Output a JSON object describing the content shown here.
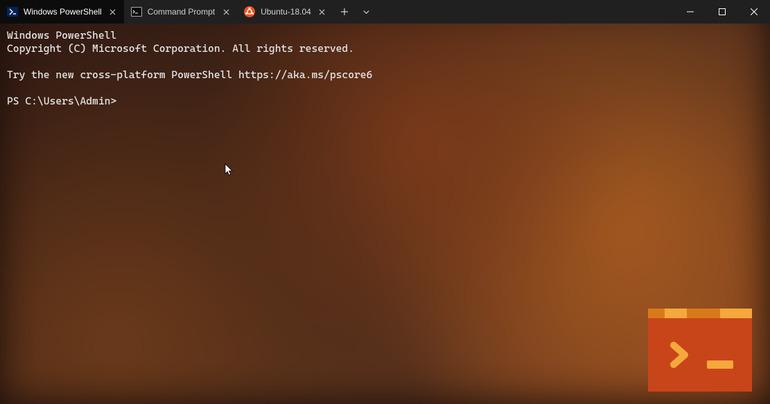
{
  "tabs": [
    {
      "label": "Windows PowerShell",
      "icon": "powershell-icon",
      "active": true
    },
    {
      "label": "Command Prompt",
      "icon": "cmd-icon",
      "active": false
    },
    {
      "label": "Ubuntu-18.04",
      "icon": "ubuntu-icon",
      "active": false
    }
  ],
  "terminal": {
    "line1": "Windows PowerShell",
    "line2": "Copyright (C) Microsoft Corporation. All rights reserved.",
    "blank1": "",
    "line3": "Try the new cross-platform PowerShell https://aka.ms/pscore6",
    "blank2": "",
    "prompt": "PS C:\\Users\\Admin>"
  }
}
